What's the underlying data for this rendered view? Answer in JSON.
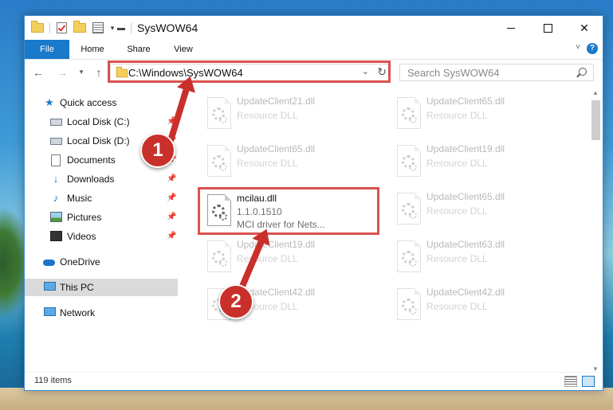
{
  "window": {
    "title": "SysWOW64",
    "minimize": "minimize",
    "maximize": "maximize",
    "close": "✕"
  },
  "ribbon": {
    "tabs": [
      "File",
      "Home",
      "Share",
      "View"
    ],
    "help": "?"
  },
  "navbar": {
    "address": "C:\\Windows\\SysWOW64",
    "search_placeholder": "Search SysWOW64"
  },
  "sidebar": {
    "items": [
      {
        "label": "Quick access",
        "icon": "star-icon",
        "pinned": false
      },
      {
        "label": "Local Disk (C:)",
        "icon": "drive-icon",
        "pinned": true
      },
      {
        "label": "Local Disk (D:)",
        "icon": "drive-icon",
        "pinned": true
      },
      {
        "label": "Documents",
        "icon": "documents-icon",
        "pinned": true
      },
      {
        "label": "Downloads",
        "icon": "downloads-icon",
        "pinned": true
      },
      {
        "label": "Music",
        "icon": "music-icon",
        "pinned": true
      },
      {
        "label": "Pictures",
        "icon": "pictures-icon",
        "pinned": true
      },
      {
        "label": "Videos",
        "icon": "videos-icon",
        "pinned": true
      },
      {
        "label": "OneDrive",
        "icon": "onedrive-icon",
        "pinned": false
      },
      {
        "label": "This PC",
        "icon": "this-pc-icon",
        "pinned": false,
        "selected": true
      },
      {
        "label": "Network",
        "icon": "network-icon",
        "pinned": false
      }
    ]
  },
  "files": [
    {
      "name": "UpdateClient21.dll",
      "line2": "Resource DLL",
      "faded": true
    },
    {
      "name": "UpdateClient65.dll",
      "line2": "Resource DLL",
      "faded": true
    },
    {
      "name": "UpdateClient65.dll",
      "line2": "Resource DLL",
      "faded": true
    },
    {
      "name": "UpdateClient19.dll",
      "line2": "Resource DLL",
      "faded": true
    },
    {
      "name": "mcilau.dll",
      "line2": "1.1.0.1510",
      "line3": "MCI driver for Nets...",
      "faded": false
    },
    {
      "name": "UpdateClient65.dll",
      "line2": "Resource DLL",
      "faded": true
    },
    {
      "name": "UpdateClient19.dll",
      "line2": "Resource DLL",
      "faded": true
    },
    {
      "name": "UpdateClient63.dll",
      "line2": "Resource DLL",
      "faded": true
    },
    {
      "name": "UpdateClient42.dll",
      "line2": "Resource DLL",
      "faded": true
    },
    {
      "name": "UpdateClient42.dll",
      "line2": "Resource DLL",
      "faded": true
    }
  ],
  "status": {
    "item_count": "119 items"
  },
  "callouts": [
    "1",
    "2"
  ],
  "colors": {
    "accent": "#1979ca",
    "highlight": "#d9534f",
    "callout": "#c9302c"
  }
}
